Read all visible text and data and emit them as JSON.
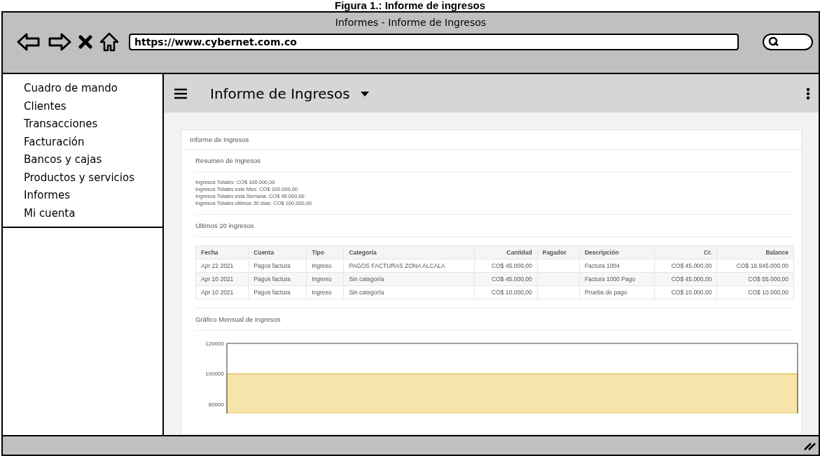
{
  "caption": "Figura 1.: Informe de ingresos",
  "window": {
    "title": "Informes - Informe de Ingresos"
  },
  "address_bar": {
    "value": "https://www.cybernet.com.co"
  },
  "sidebar": {
    "items": [
      {
        "label": "Cuadro de mando"
      },
      {
        "label": "Clientes"
      },
      {
        "label": "Transacciones"
      },
      {
        "label": "Facturación"
      },
      {
        "label": "Bancos y cajas"
      },
      {
        "label": "Productos y servicios"
      },
      {
        "label": "Informes"
      },
      {
        "label": "Mi cuenta"
      }
    ]
  },
  "header": {
    "title": "Informe de Ingresos"
  },
  "panel": {
    "title": "Informe de Ingresos",
    "summary_title": "Resumen de Ingresos",
    "summary_lines": [
      "Ingresos Totales: CO$ 100.000,00",
      "Ingresos Totales este Mes: CO$ 100.000,00",
      "Ingresos Totales esta Semana: CO$ 45.000,00",
      "Ingresos Totales últimos 30 días: CO$ 100.000,00"
    ],
    "latest_title": "Últimos 20 ingresos",
    "table": {
      "columns": [
        "Fecha",
        "Cuenta",
        "Tipo",
        "Categoría",
        "Cantidad",
        "Pagador",
        "Descripción",
        "Cr.",
        "Balance"
      ],
      "rows": [
        [
          "Apr 22 2021",
          "Pagos factura",
          "Ingreso",
          "PAGOS FACTURAS ZONA ALCALA",
          "CO$ 45.000,00",
          "",
          "Factura 1004",
          "CO$ 45.000,00",
          "CO$ 19.945.000,00"
        ],
        [
          "Apr 10 2021",
          "Pagos factura",
          "Ingreso",
          "Sin categoría",
          "CO$ 45.000,00",
          "",
          "Factura 1000 Pago",
          "CO$ 45.000,00",
          "CO$ 55.000,00"
        ],
        [
          "Apr 10 2021",
          "Pagos factura",
          "Ingreso",
          "Sin categoría",
          "CO$ 10.000,00",
          "",
          "Prueba de pago",
          "CO$ 10.000,00",
          "CO$ 10.000,00"
        ]
      ]
    },
    "chart_title": "Gráfico Mensual de Ingresos",
    "chart_data": {
      "type": "bar",
      "values": [
        100000
      ],
      "ylim": [
        74000,
        120000
      ],
      "yticks": [
        80000,
        100000,
        120000
      ]
    }
  }
}
